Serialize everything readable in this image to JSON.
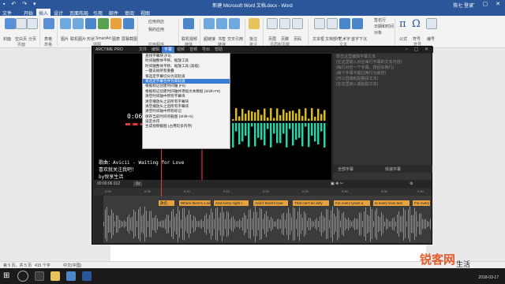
{
  "word": {
    "title": "新建 Microsoft Word 文档.docx - Word",
    "user": "陈七 登录",
    "tabs": [
      "文件",
      "开始",
      "插入",
      "设计",
      "页面布局",
      "引用",
      "邮件",
      "审阅",
      "视图"
    ],
    "active_tab": "插入",
    "ribbon": {
      "buttons": [
        "封面",
        "空白页",
        "分页",
        "表格",
        "图片",
        "联机图片",
        "形状",
        "SmartArt",
        "图表",
        "屏幕截图",
        "应用商店",
        "我的应用",
        "联机视频",
        "超链接",
        "书签",
        "交叉引用",
        "批注",
        "页眉",
        "页脚",
        "页码",
        "文本框",
        "文档部件",
        "艺术字",
        "首字下沉",
        "公式",
        "符号",
        "编号"
      ],
      "groups": [
        "页面",
        "表格",
        "插图",
        "应用程序",
        "媒体",
        "链接",
        "批注",
        "页眉和页脚",
        "文本",
        "符号"
      ],
      "side_items": [
        "签名行",
        "日期和时间",
        "对象"
      ]
    },
    "status": {
      "page": "第 5 页，共 5 页",
      "words": "415 个字",
      "lang": "中文(中国)"
    }
  },
  "taskbar": {
    "time": "2018-03-17"
  },
  "arctime": {
    "logo": "ARCTIME PRO",
    "menu": [
      "文件",
      "编辑",
      "字幕",
      "视频",
      "音频",
      "导出",
      "帮助"
    ],
    "active_menu": "字幕",
    "preview": {
      "time": "0:06/0:",
      "lyric1": "歌曲：Avicii - Waiting for Love",
      "lyric2": "喜欢就关注我吧！",
      "lyric3": "by悦享生活"
    },
    "side_text": [
      "单击这里编辑字幕文本",
      "(在这里输入对应每行字幕的文本内容)",
      "(每行对应一个字幕，按回车换行)",
      "(每个字幕不超过两行为最佳)",
      "(可以直接粘贴整段文本)",
      "(在这里输入或粘贴文本)"
    ],
    "side_tools": {
      "left": "全部字幕",
      "right": "快速字幕"
    },
    "context_menu": [
      "查找字幕块 (F3)",
      "时间轴整体平移、缩放工具",
      "时间轴整体平移、缩放工具 (高级)",
      "一键去除所有重叠",
      "将选定字幕切分为双轨道",
      "将选定字幕合并为单轨道",
      "根据标记创建时间轴 (F8)",
      "根据标记创建时间轴并添加文本数据 (Shift+F8)",
      "清空时间轴中所有字幕块",
      "清空播放头之前所有字幕块",
      "清空播放头之后所有字幕块",
      "清空时间轴中所有标记",
      "保存当前时间点截图 (Shift+S)",
      "设定水印",
      "生成视频截图 (占用较多内存)"
    ],
    "highlight_index": 5,
    "toolbar": {
      "time": "00:00:06.912",
      "zoom": "1x"
    },
    "timeline_marks": [
      "0:00",
      "0:05",
      "0:10",
      "0:15",
      "0:20",
      "0:25",
      "0:30",
      "0:35",
      "0:40"
    ],
    "clips": [
      "歌名：",
      "Where there's a will",
      "And every night I.",
      "And every night I.",
      "And if there's love",
      "That can't be defy",
      "For every tyrant a",
      "Is every lovin test",
      "For every"
    ]
  },
  "watermark": {
    "brand": "锐客网",
    "sub": "生活"
  }
}
